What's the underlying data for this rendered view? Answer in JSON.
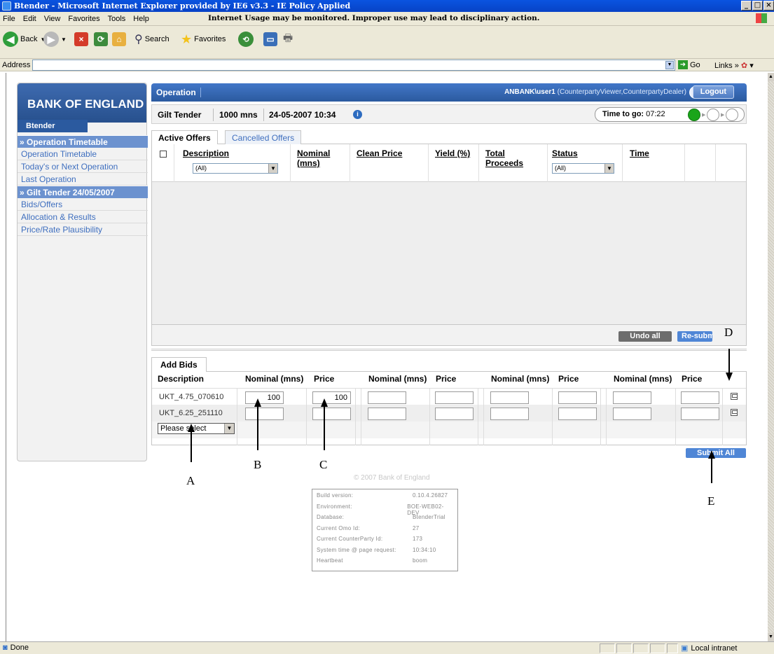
{
  "window": {
    "title": "Btender - Microsoft Internet Explorer provided by IE6 v3.3 - IE Policy Applied"
  },
  "menu": {
    "items": [
      "File",
      "Edit",
      "View",
      "Favorites",
      "Tools",
      "Help"
    ],
    "notice": "Internet Usage may be monitored. Improper use may lead to disciplinary action."
  },
  "toolbar": {
    "back": "Back",
    "search": "Search",
    "favorites": "Favorites"
  },
  "addressbar": {
    "label": "Address",
    "value": "",
    "go": "Go",
    "links": "Links"
  },
  "sidebar": {
    "logo": "BANK OF ENGLAND",
    "app_tab": "Btender",
    "sections": [
      {
        "heading": "» Operation Timetable",
        "links": [
          "Operation Timetable",
          "Today's or Next Operation",
          "Last Operation"
        ]
      },
      {
        "heading": "» Gilt Tender 24/05/2007",
        "links": [
          "Bids/Offers",
          "Allocation & Results",
          "Price/Rate Plausibility"
        ]
      }
    ]
  },
  "header": {
    "title": "Operation",
    "user": "ANBANK\\user1",
    "roles": "(CounterpartyViewer,CounterpartyDealer)",
    "logout": "Logout"
  },
  "info": {
    "tender": "Gilt Tender",
    "amount": "1000 mns",
    "datetime": "24-05-2007 10:34",
    "time_to_go_label": "Time to go:",
    "time_to_go": "07:22"
  },
  "offers_tabs": [
    "Active Offers",
    "Cancelled Offers"
  ],
  "offers_grid": {
    "columns": [
      "Description",
      "Nominal (mns)",
      "Clean Price",
      "Yield (%)",
      "Total Proceeds",
      "Status",
      "Time"
    ],
    "description_filter": "(All)",
    "status_filter": "(All)"
  },
  "offer_buttons": {
    "undo_all": "Undo all",
    "resubmit": "Re-submit"
  },
  "add_bids": {
    "tab": "Add Bids",
    "columns": [
      "Description",
      "Nominal (mns)",
      "Price",
      "Nominal (mns)",
      "Price",
      "Nominal (mns)",
      "Price",
      "Nominal (mns)",
      "Price"
    ],
    "rows": [
      {
        "description": "UKT_4.75_070610",
        "nominal": "100",
        "price": "100"
      },
      {
        "description": "UKT_6.25_251110",
        "nominal": "",
        "price": ""
      }
    ],
    "select_placeholder": "Please select",
    "submit_all": "Submit All"
  },
  "annotations": [
    "A",
    "B",
    "C",
    "D",
    "E"
  ],
  "footer": {
    "copyright": "© 2007 Bank of England",
    "build": [
      {
        "k": "Build version:",
        "v": "0.10.4.26827"
      },
      {
        "k": "Environment:",
        "v": "BOE-WEB02-DEV"
      },
      {
        "k": "Database:",
        "v": "BtenderTrial"
      },
      {
        "k": "Current Omo Id:",
        "v": "27"
      },
      {
        "k": "Current CounterParty Id:",
        "v": "173"
      },
      {
        "k": "System time @ page request:",
        "v": "10:34:10"
      },
      {
        "k": "Heartbeat",
        "v": "boom"
      }
    ]
  },
  "status": {
    "left": "Done",
    "zone": "Local intranet"
  },
  "colors": {
    "titlebar": "#0a54e0",
    "header_blue": "#2b5a9f",
    "link_blue": "#3f6fbf",
    "sidebar_heading": "#6c92cf",
    "action_blue": "#4f86d6",
    "timer_green": "#1aa51a"
  }
}
